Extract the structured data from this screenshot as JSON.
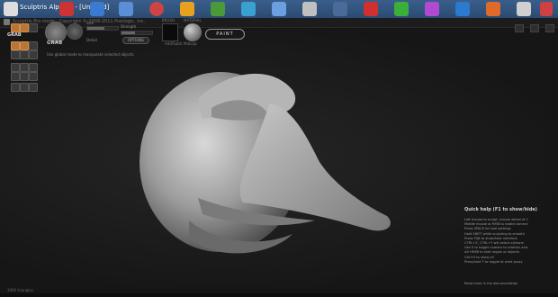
{
  "taskbar": {
    "window_title": "Sculptris Alpha 6 - [Untitled]"
  },
  "titlebar": {
    "subtitle": "Sculptris Pro mode · Copyright © 2009-2011 Pixologic, Inc."
  },
  "toolbox": {
    "grab_label": "GRAB"
  },
  "controls": {
    "grab_label": "GRAB",
    "size_label": "Size",
    "strength_label": "Strength",
    "detail_label": "Detail",
    "options_label": "OPTIONS",
    "brush_label": "BRUSH",
    "brush_sub": "Add/Subtr",
    "material_label": "MATERIAL",
    "material_sub": "Matcap",
    "paint_label": "PAINT",
    "size_value": 0.55,
    "strength_value": 0.45
  },
  "hint": "Use global mode to manipulate selected objects",
  "help": {
    "title": "Quick help (F1 to show/hide)",
    "lines": [
      "Left mouse to sculpt, mouse wheel at 1",
      "Middle mouse or RMB to rotate camera",
      "Press SPACE for tool settings",
      "Hold SHIFT while sculpting to smooth",
      "Press TAB to show/hide interface",
      "CTRL+Z, CTRL+Y will select all/none",
      "Use E to toggle camera to rotation axis",
      "Alt+RMB to hide region or objects",
      "Ctrl+H to show all",
      "Press/hold F to toggle at wrist proxy"
    ],
    "footer": "Read more in the documentation"
  },
  "status": {
    "poly_count": "1960 triangles"
  }
}
